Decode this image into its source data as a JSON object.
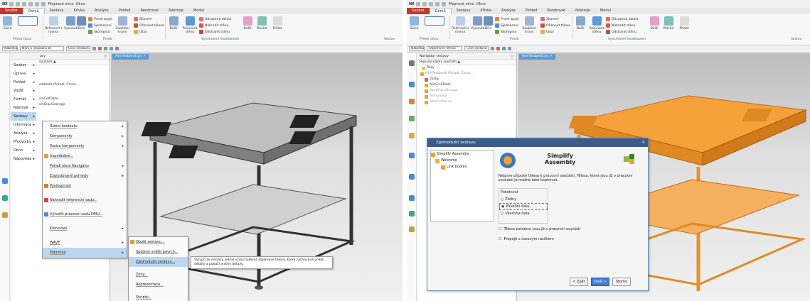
{
  "app": {
    "logo": "NX",
    "switch_window": "Přepnout okno",
    "window": "Okno"
  },
  "colors": {
    "accent": "#c0392b",
    "highlight": "#bcd7f0",
    "orange": "#f7a13a",
    "dialog_title": "#3c5b88"
  },
  "tabs": [
    "Soubor",
    "Domů",
    "Sestavy",
    "Křivka",
    "Analýza",
    "Pohled",
    "Rendrovat",
    "Nástroje",
    "Modul"
  ],
  "ribbon": {
    "skica": "Skica",
    "ref_plane": "Referenční rovina",
    "extrude": "Vysunutí",
    "hole": "Díra",
    "skin": "Zaoblení hrany",
    "shell": "Skořepina",
    "edge_blend": "Úkos",
    "sketch_group": "Přímá skica",
    "feature_group": "Prvek",
    "unite": "Prvek spoje",
    "subtract": "Sjednocení",
    "trim": "Oříznout těleso",
    "shell2": "Skořepina",
    "pattern": "Zkosení",
    "delete_face": "Odstranit stěnu",
    "move_face": "Posunout stěnu",
    "offset_region": "Odsazená oblast",
    "replace_face": "Nahradit stěnu",
    "more": "Další",
    "surface": "Plocha",
    "add": "Přidat",
    "sync_group": "Synchronní modelování",
    "ctx": "Sestav"
  },
  "toolbar": {
    "menu": "Nabídka",
    "filter_left": "Není k dispozici že",
    "filter_right": "Objemové těleso",
    "scope": "Celá sestava"
  },
  "viewport_tab": "AsmTestbed4.prt",
  "navigator": {
    "title": "Navigátor sestavy",
    "column": "Popisný název součásti",
    "col_short": "součásti",
    "items": [
      "Řezy",
      "AsmTestbed4 (Pořadí: Chron...",
      "Vazby",
      "AsmCellTable",
      "AsmGlassStorage",
      "AsmGooda",
      "AsmCellServe"
    ],
    "left_items": [
      "estbed4 (Pořadí: Chron...",
      "smCellTable",
      "smGlassStorage"
    ]
  },
  "menubar": [
    "Soubor",
    "Úpravy",
    "Pohled",
    "Vložit",
    "Formát",
    "Nástroje",
    "Sestavy",
    "Informace",
    "Analýza",
    "Předvolby",
    "Okno",
    "Nápověda"
  ],
  "menubar_extra": "avy",
  "sestavy_menu": [
    "Řízení kontextu",
    "Komponenty",
    "Pozice komponenty",
    "Uspořádání...",
    "Pořadí okna Navigátor",
    "Exploduvané pohledy",
    "Posloupnost",
    "Nahradit referenční sadu...",
    "Vytvořit pracovní sadu DMU...",
    "Klonování",
    "WAVE",
    "Pokročilé"
  ],
  "pokrocile_menu": [
    "Obalit sestavu...",
    "Spojený vnější povrch...",
    "Zjednodušit sestavu...",
    "Zóny...",
    "Reprezentace...",
    "Skripty..."
  ],
  "tooltip": "Vytvoří ze sestavy jediné vzduchotěsné objemové těleso, které zachovává vnější detaily a potlačí vnitřní detaily.",
  "dialog": {
    "title": "Zjednodušit sestavu",
    "steps": [
      "Simplify Assembly",
      "Welcome",
      "Link bodies"
    ],
    "heading1": "Simplify",
    "heading2": "Assembly",
    "desc": "Nejprve připojte tělesa k pracovní součásti. Tělesa, která jsou již v pracovní součásti je možné také kopírovat.",
    "group_label": "Pokotovar",
    "options": [
      "Žádný",
      "Původní data",
      "Všechna data"
    ],
    "check1": "Tělesa extrakce jsou již v pracovní součásti",
    "check2": "Propojit s časovým razítkem",
    "back": "< Zpět",
    "next": "Další >",
    "cancel": "Storno"
  }
}
